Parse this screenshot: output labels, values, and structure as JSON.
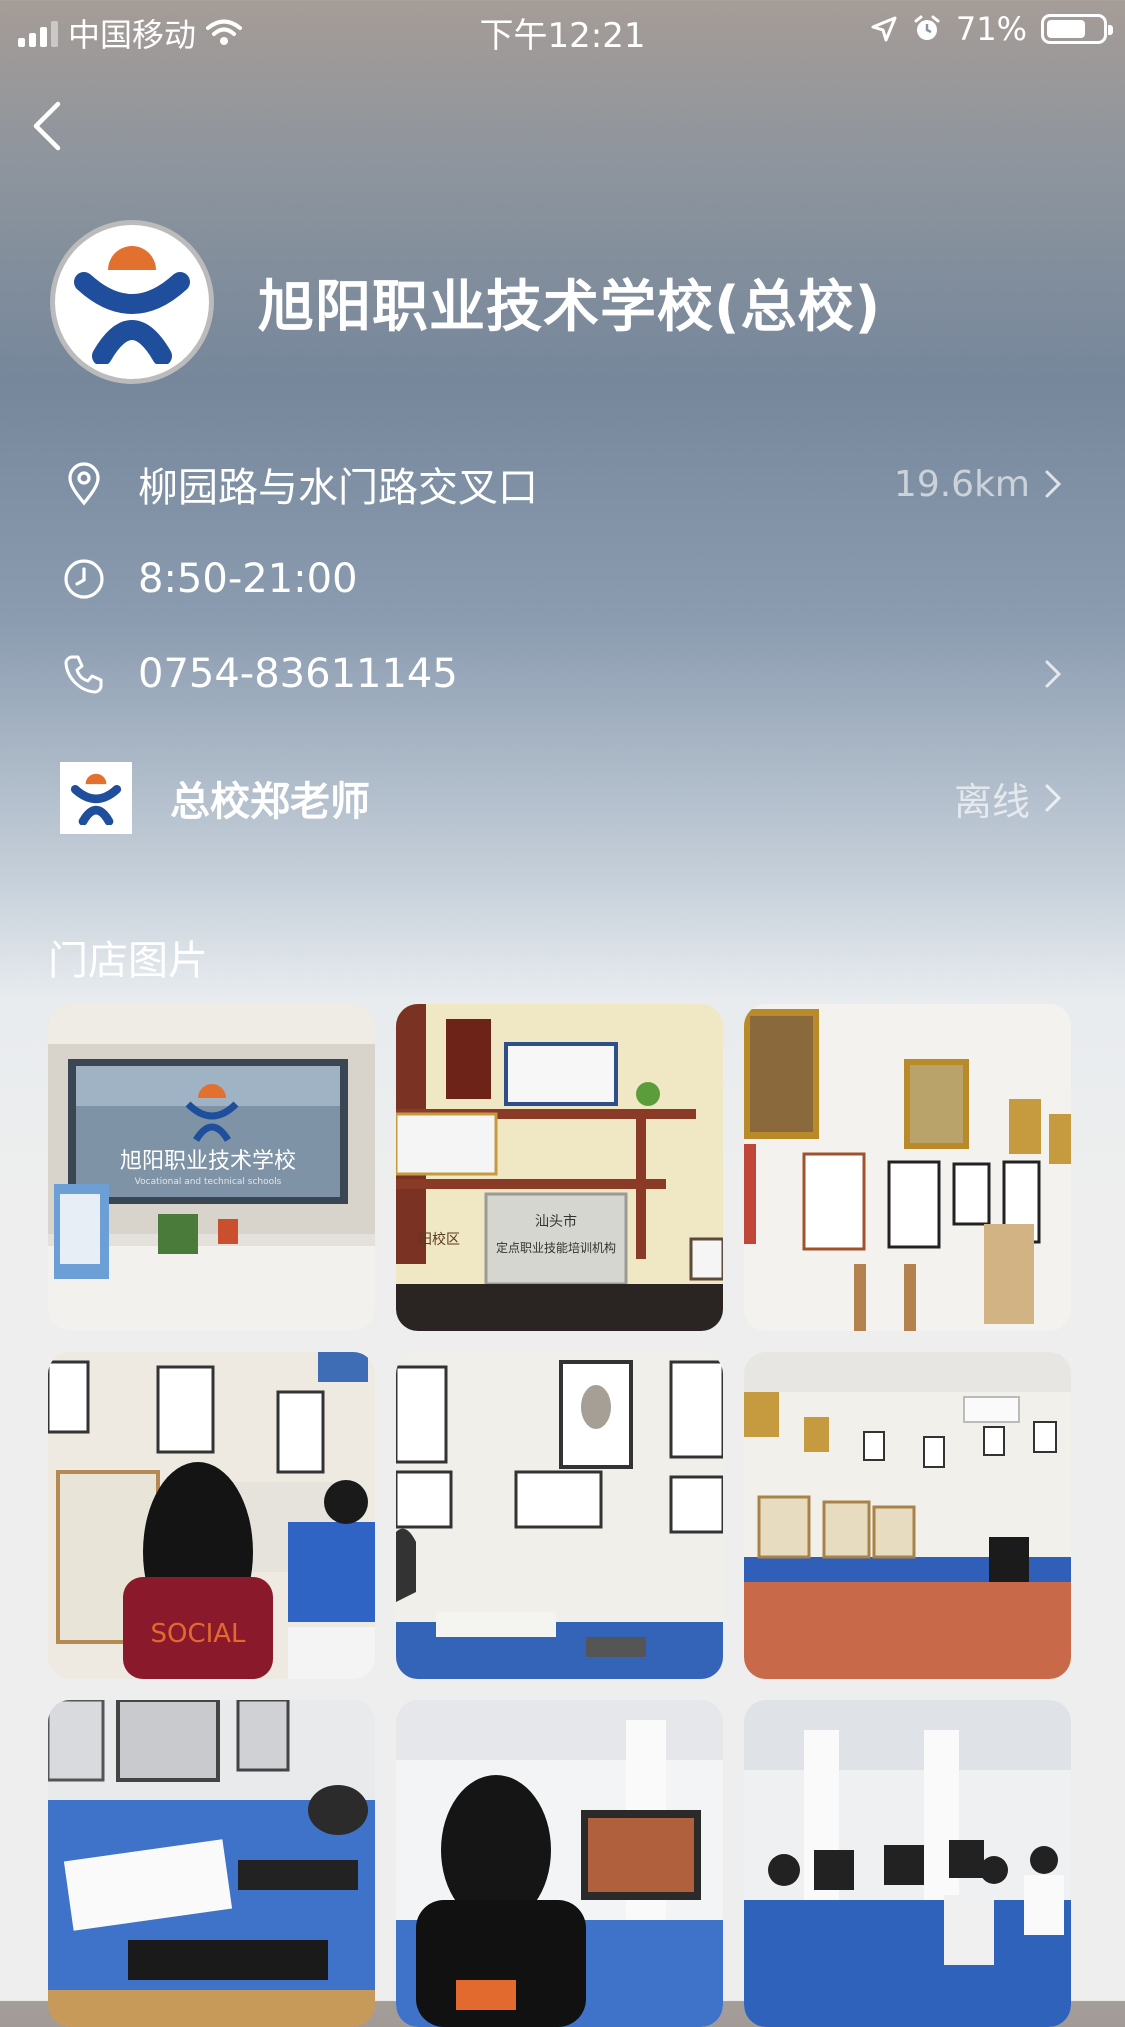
{
  "status_bar": {
    "carrier": "中国移动",
    "time": "下午12:21",
    "battery_text": "71%",
    "battery_level": 0.71,
    "icons": [
      "signal-icon",
      "wifi-icon",
      "location-arrow-icon",
      "alarm-icon",
      "battery-icon"
    ]
  },
  "nav": {
    "back_icon": "chevron-left-icon"
  },
  "store": {
    "name": "旭阳职业技术学校(总校)",
    "address": "柳园路与水门路交叉口",
    "distance": "19.6km",
    "hours": "8:50-21:00",
    "phone": "0754-83611145"
  },
  "contact": {
    "name": "总校郑老师",
    "status": "离线"
  },
  "photos": {
    "title": "门店图片",
    "items": [
      {
        "sign_text": "旭阳职业技术学校",
        "sign_sub": "Vocational and technical schools"
      },
      {
        "plaque_title": "汕头市",
        "plaque_text": "定点职业技能培训机构",
        "plaque_left": "阳校区"
      },
      {},
      {
        "shirt_text": "SOCIAL"
      },
      {},
      {},
      {},
      {},
      {}
    ]
  },
  "colors": {
    "brand_blue": "#1f4e9c",
    "brand_orange": "#e2712f"
  }
}
